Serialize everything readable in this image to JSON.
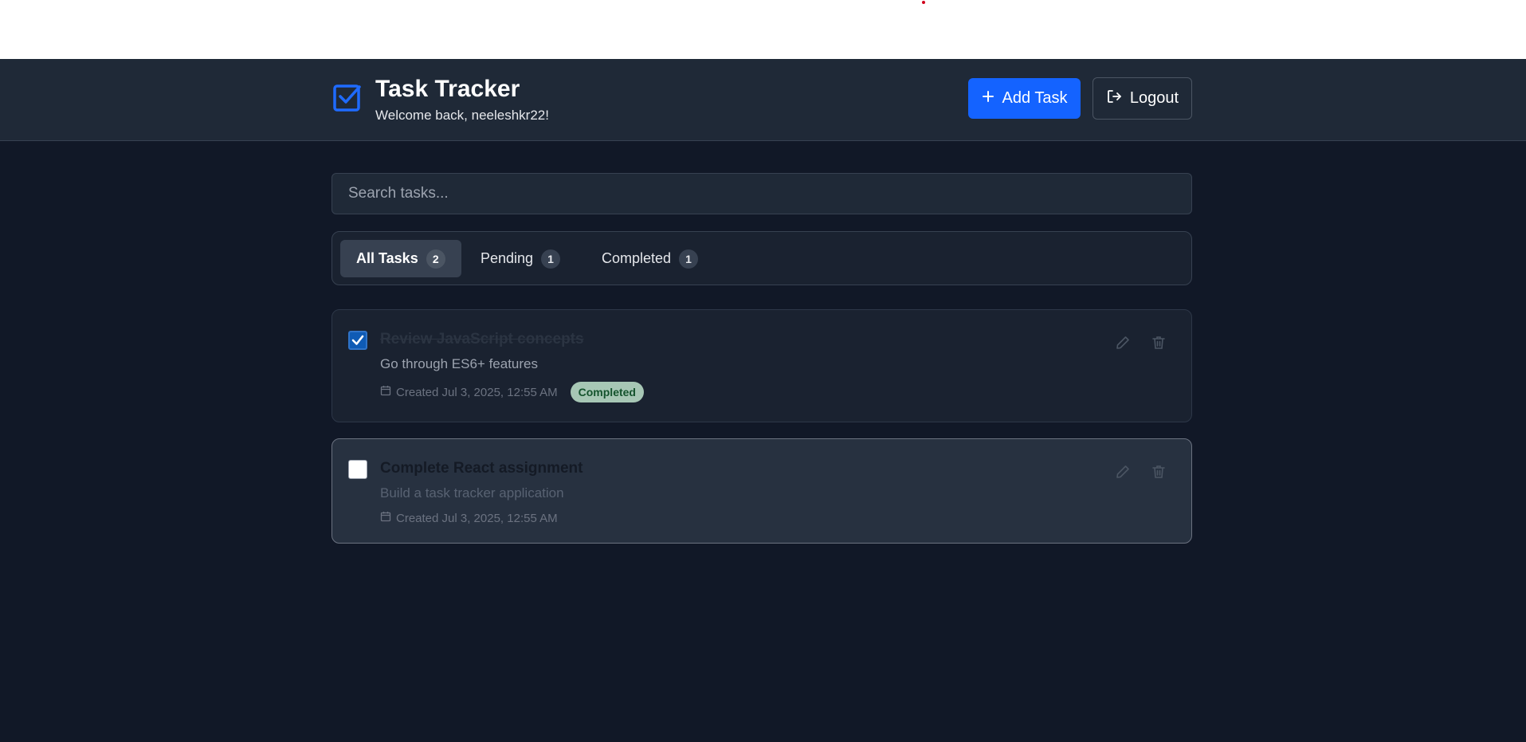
{
  "header": {
    "title": "Task Tracker",
    "welcome": "Welcome back, neeleshkr22!",
    "add_task_label": "Add Task",
    "logout_label": "Logout"
  },
  "search": {
    "placeholder": "Search tasks..."
  },
  "tabs": [
    {
      "label": "All Tasks",
      "count": "2",
      "active": true
    },
    {
      "label": "Pending",
      "count": "1",
      "active": false
    },
    {
      "label": "Completed",
      "count": "1",
      "active": false
    }
  ],
  "tasks": [
    {
      "title": "Review JavaScript concepts",
      "description": "Go through ES6+ features",
      "created": "Created Jul 3, 2025, 12:55 AM",
      "completed": true,
      "status": "Completed"
    },
    {
      "title": "Complete React assignment",
      "description": "Build a task tracker application",
      "created": "Created Jul 3, 2025, 12:55 AM",
      "completed": false
    }
  ],
  "colors": {
    "background": "#111827",
    "header": "#1f2937",
    "accent": "#1463ff",
    "completed_badge": "#a7c7b5"
  },
  "icons": {
    "logo": "check-square-icon",
    "add": "plus-icon",
    "logout": "log-out-icon",
    "calendar": "calendar-icon",
    "edit": "pencil-icon",
    "delete": "trash-icon"
  }
}
